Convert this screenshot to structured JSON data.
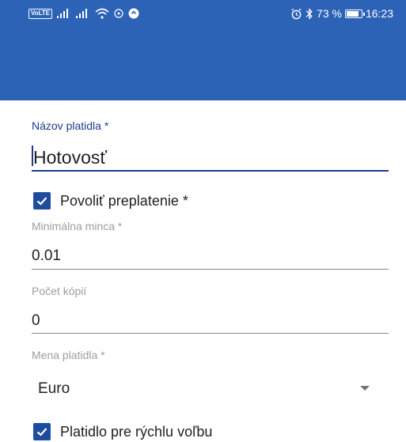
{
  "status_bar": {
    "volte": "VoLTE",
    "battery_text": "73 %",
    "time": "16:23"
  },
  "form": {
    "tender_name": {
      "label": "Názov platidla *",
      "value": "Hotovosť"
    },
    "allow_overpayment": {
      "label": "Povoliť preplatenie *",
      "checked": true
    },
    "min_coin": {
      "label": "Minimálna minca *",
      "value": "0.01"
    },
    "copies": {
      "label": "Počet kópií",
      "value": "0"
    },
    "currency": {
      "label": "Mena platidla *",
      "value": "Euro"
    },
    "quick_select": {
      "label": "Platidlo pre rýchlu voľbu",
      "checked": true
    }
  },
  "colors": {
    "app_bar": "#2d63b6",
    "accent": "#1e3a8a",
    "checkbox": "#1f4d9e"
  }
}
